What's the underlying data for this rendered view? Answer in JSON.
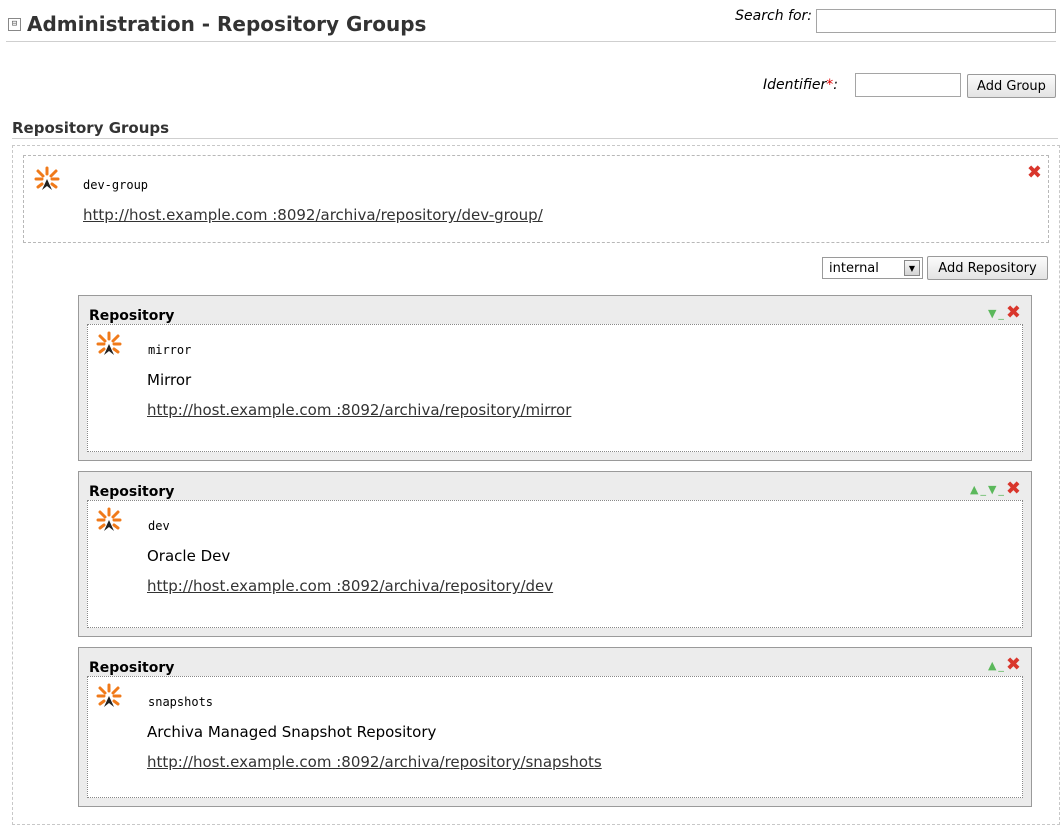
{
  "header": {
    "title": "Administration - Repository Groups",
    "collapse_glyph": "⊟"
  },
  "search": {
    "label": "Search for:",
    "value": ""
  },
  "add_group": {
    "label": "Identifier",
    "required": "*",
    "colon": ":",
    "value": "",
    "button_label": "Add Group"
  },
  "section": {
    "title": "Repository Groups"
  },
  "group": {
    "id": "dev-group",
    "url": "http://host.example.com :8092/archiva/repository/dev-group/",
    "remove_glyph": "✖"
  },
  "add_repository": {
    "selected": "internal",
    "button_label": "Add Repository"
  },
  "repositories": [
    {
      "header": "Repository",
      "id": "mirror",
      "name": "Mirror",
      "url": "http://host.example.com :8092/archiva/repository/mirror",
      "up": false,
      "down": true
    },
    {
      "header": "Repository",
      "id": "dev",
      "name": "Oracle Dev",
      "url": "http://host.example.com :8092/archiva/repository/dev",
      "up": true,
      "down": true
    },
    {
      "header": "Repository",
      "id": "snapshots",
      "name": "Archiva Managed Snapshot Repository",
      "url": "http://host.example.com :8092/archiva/repository/snapshots",
      "up": true,
      "down": false
    }
  ],
  "glyphs": {
    "up": "▲",
    "down": "▼",
    "sep": "_",
    "remove": "✖",
    "dropdown": "▼"
  },
  "colors": {
    "remove": "#d9362c",
    "arrows": "#5bb85b",
    "logo_orange": "#f07a1a",
    "logo_dark": "#222222"
  }
}
